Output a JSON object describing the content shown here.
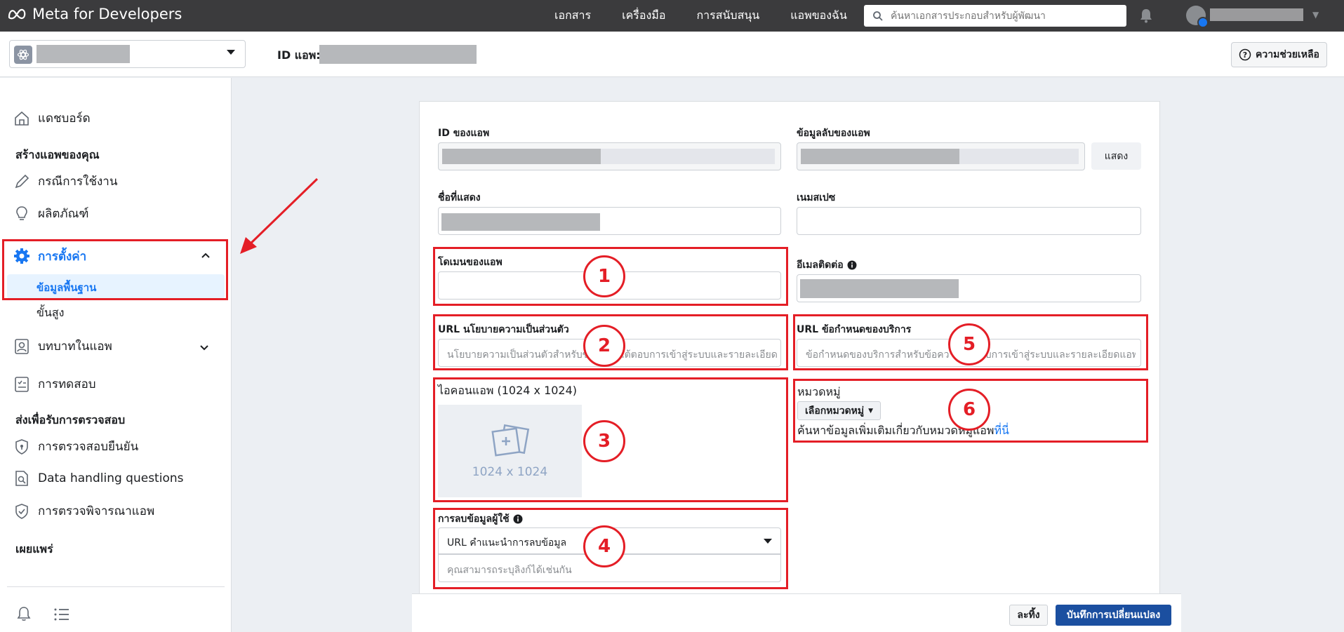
{
  "topbar": {
    "brand": "Meta for Developers",
    "nav": [
      "เอกสาร",
      "เครื่องมือ",
      "การสนับสนุน",
      "แอพของฉัน"
    ],
    "search_placeholder": "ค้นหาเอกสารประกอบสำหรับผู้พัฒนา"
  },
  "subheader": {
    "app_id_label": "ID แอพ:",
    "help_label": "ความช่วยเหลือ"
  },
  "sidebar": {
    "dashboard": "แดชบอร์ด",
    "build_section": "สร้างแอพของคุณ",
    "use_cases": "กรณีการใช้งาน",
    "products": "ผลิตภัณฑ์",
    "settings": "การตั้งค่า",
    "basic": "ข้อมูลพื้นฐาน",
    "advanced": "ขั้นสูง",
    "app_roles": "บทบาทในแอพ",
    "testing": "การทดสอบ",
    "review_section": "ส่งเพื่อรับการตรวจสอบ",
    "verification": "การตรวจสอบยืนยัน",
    "data_handling": "Data handling questions",
    "app_review": "การตรวจพิจารณาแอพ",
    "publish_section": "เผยแพร่"
  },
  "form": {
    "app_id_label": "ID ของแอพ",
    "app_secret_label": "ข้อมูลลับของแอพ",
    "show_label": "แสดง",
    "display_name_label": "ชื่อที่แสดง",
    "namespace_label": "เนมสเปซ",
    "app_domains_label": "โดเมนของแอพ",
    "contact_email_label": "อีเมลติดต่อ",
    "privacy_url_label": "URL นโยบายความเป็นส่วนตัว",
    "privacy_url_placeholder": "นโยบายความเป็นส่วนตัวสำหรับข้อความโต้ตอบการเข้าสู่ระบบและรายละเอียดแอพ",
    "tos_url_label": "URL ข้อกำหนดของบริการ",
    "tos_url_placeholder": "ข้อกำหนดของบริการสำหรับข้อความโต้ตอบการเข้าสู่ระบบและรายละเอียดแอพ",
    "app_icon_label": "ไอคอนแอพ (1024 x 1024)",
    "app_icon_size": "1024 x 1024",
    "category_label": "หมวดหมู่",
    "category_button": "เลือกหมวดหมู่",
    "category_note": "ค้นหาข้อมูลเพิ่มเติมเกี่ยวกับหมวดหมู่แอพ",
    "category_link": "ที่นี่",
    "data_deletion_label": "การลบข้อมูลผู้ใช้",
    "data_deletion_select": "URL คำแนะนำการลบข้อมูล",
    "data_deletion_placeholder": "คุณสามารถระบุลิงก์ได้เช่นกัน"
  },
  "annotations": [
    "1",
    "2",
    "3",
    "4",
    "5",
    "6"
  ],
  "footer": {
    "cancel_label": "ละทิ้ง",
    "save_label": "บันทึกการเปลี่ยนแปลง"
  },
  "colors": {
    "accent": "#1877f2",
    "highlight": "#e41e26",
    "save": "#1b4fa0"
  }
}
